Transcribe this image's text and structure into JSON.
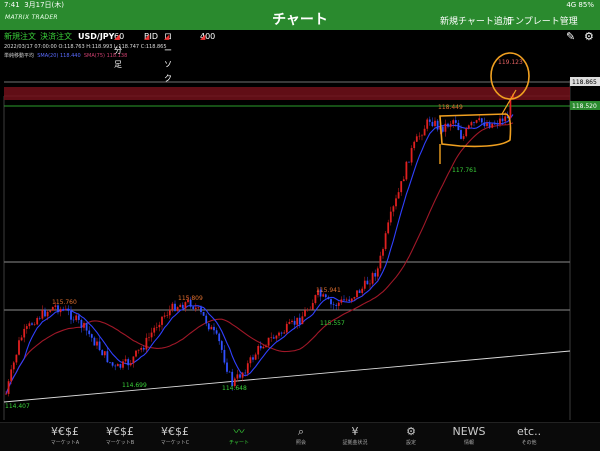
{
  "status": {
    "time": "7:41",
    "date": "3月17日(木)",
    "signal": "4G 85%"
  },
  "header": {
    "logo": "MATRIX TRADER",
    "title": "チャート",
    "add_chart": "新規チャート追加",
    "template": "テンプレート管理"
  },
  "toolbar": {
    "new_order": "新規注文",
    "settle_order": "決済注文",
    "pair": "USD/JPY",
    "timeframe": "60分足",
    "side": "BID",
    "chart_type": "ローソク",
    "count": "400"
  },
  "indicator": {
    "ohlc": "2022/03/17 07:00:00  O:118.763  H:118.993  L:118.747  C:118.865",
    "name": "単純移動平均",
    "ma20": "SMA(20) 118.440",
    "ma75": "SMA(75) 118.138"
  },
  "colors": {
    "header": "#2a8a2e",
    "ma20": "#3040ff",
    "ma75": "#a01828",
    "up": "#e02020",
    "down": "#3050ff"
  },
  "price_tags": {
    "current": "118.865",
    "green_line": "118.520"
  },
  "annotations": {
    "p1": "119.123",
    "p2": "118.449",
    "p3": "117.761",
    "p4": "115.941",
    "p5": "115.557",
    "p6": "115.760",
    "p7": "115.809",
    "p8": "114.699",
    "p9": "114.648",
    "p10": "114.407"
  },
  "tabs": [
    {
      "icon": "¥€$£",
      "label": "マーケットA"
    },
    {
      "icon": "¥€$£",
      "label": "マーケットB"
    },
    {
      "icon": "¥€$£",
      "label": "マーケットC"
    },
    {
      "icon": "chart-icon",
      "label": "チャート"
    },
    {
      "icon": "search-icon",
      "label": "照会"
    },
    {
      "icon": "yen-icon",
      "label": "証拠金状況"
    },
    {
      "icon": "gear-icon",
      "label": "設定"
    },
    {
      "icon": "NEWS",
      "label": "情報"
    },
    {
      "icon": "etc..",
      "label": "その他"
    }
  ]
}
